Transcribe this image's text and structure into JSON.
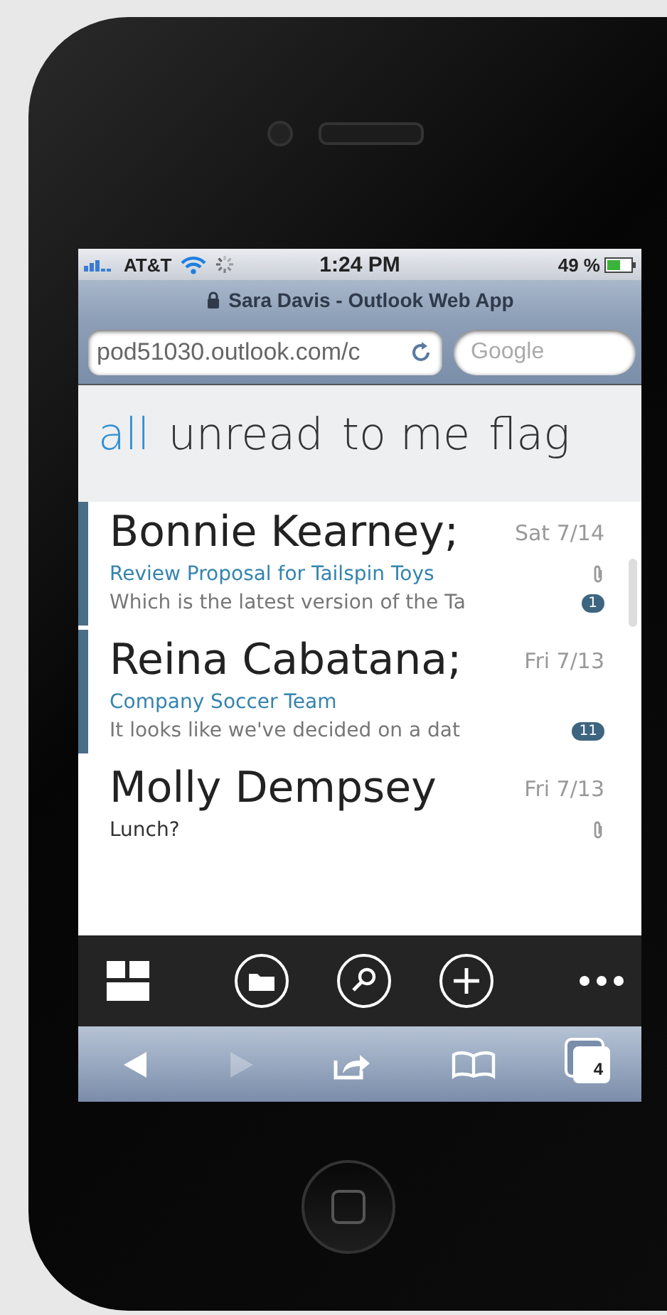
{
  "status_bar": {
    "carrier": "AT&T",
    "time": "1:24 PM",
    "battery": "49 %",
    "loading": true
  },
  "browser": {
    "title": "Sara Davis - Outlook Web App",
    "url": "pod51030.outlook.com/c",
    "search_placeholder": "Google",
    "tab_count": "4",
    "forward_disabled": true
  },
  "tabs": [
    {
      "label": "all",
      "selected": true
    },
    {
      "label": "unread",
      "selected": false
    },
    {
      "label": "to me",
      "selected": false
    },
    {
      "label": "flag",
      "selected": false
    }
  ],
  "messages": [
    {
      "sender": "Bonnie Kearney;",
      "date": "Sat 7/14",
      "subject": "Review Proposal for Tailspin Toys",
      "preview": "Which is the latest version of the Ta",
      "unread": true,
      "attachment": true,
      "count": "1"
    },
    {
      "sender": "Reina Cabatana;",
      "date": "Fri 7/13",
      "subject": "Company Soccer Team",
      "preview": "It looks like we've decided on a dat",
      "unread": true,
      "attachment": false,
      "count": "11"
    },
    {
      "sender": "Molly Dempsey",
      "date": "Fri 7/13",
      "subject": "Lunch?",
      "unread": false,
      "attachment": true
    }
  ]
}
